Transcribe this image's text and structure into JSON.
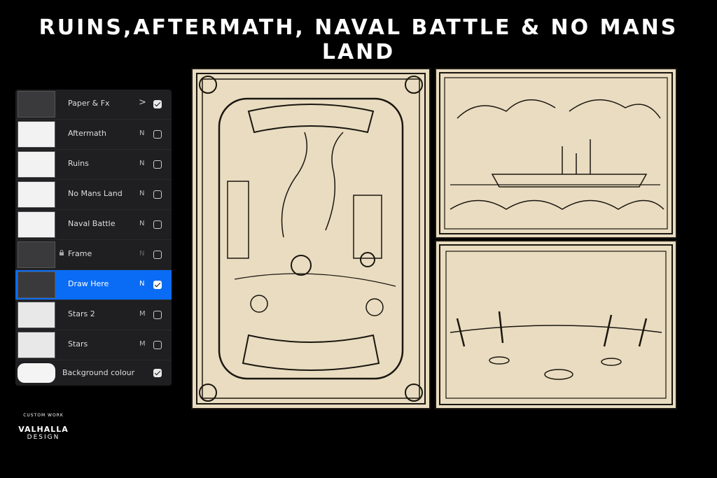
{
  "headline": "RUINS,AFTERMATH, NAVAL BATTLE & NO MANS LAND",
  "layers": [
    {
      "name": "Paper & Fx",
      "mode": "",
      "chevron": ">",
      "checked": true,
      "thumb": "dark"
    },
    {
      "name": "Aftermath",
      "mode": "N",
      "checked": false,
      "thumb": "sketch"
    },
    {
      "name": "Ruins",
      "mode": "N",
      "checked": false,
      "thumb": "sketch"
    },
    {
      "name": "No Mans Land",
      "mode": "N",
      "checked": false,
      "thumb": "sketch"
    },
    {
      "name": "Naval Battle",
      "mode": "N",
      "checked": false,
      "thumb": "sketch"
    },
    {
      "name": "Frame",
      "mode": "N",
      "checked": false,
      "locked": true,
      "thumb": "dark"
    },
    {
      "name": "Draw Here",
      "mode": "N",
      "checked": true,
      "selected": true,
      "thumb": "dark"
    },
    {
      "name": "Stars 2",
      "mode": "M",
      "checked": false,
      "thumb": "light"
    },
    {
      "name": "Stars",
      "mode": "M",
      "checked": false,
      "thumb": "light"
    }
  ],
  "background_layer": {
    "label": "Background colour",
    "checked": true
  },
  "logo": {
    "line1": "CUSTOM WORK",
    "line2": "VALHALLA",
    "line3": "DESIGN"
  },
  "colors": {
    "accent": "#0a6cf5",
    "paper": "#e9dcc0",
    "ink": "#1a1610"
  }
}
